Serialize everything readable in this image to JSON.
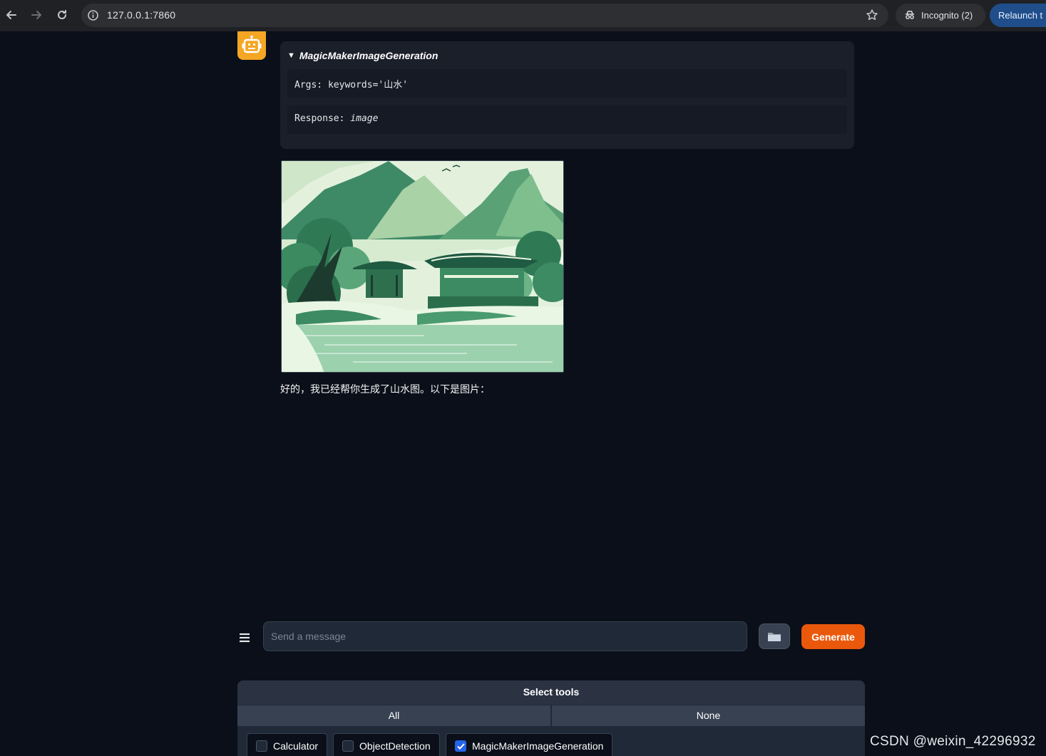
{
  "browser": {
    "url": "127.0.0.1:7860",
    "incognito_label": "Incognito (2)",
    "relaunch_label": "Relaunch t"
  },
  "chat": {
    "tool_call": {
      "name": "MagicMakerImageGeneration",
      "args_label": "Args: ",
      "args_value": "keywords='山水'",
      "response_label": "Response: ",
      "response_value": "image"
    },
    "reply_text": "好的，我已经帮你生成了山水图。以下是图片："
  },
  "input": {
    "placeholder": "Send a message",
    "generate_label": "Generate"
  },
  "tools": {
    "header": "Select tools",
    "all_label": "All",
    "none_label": "None",
    "items": [
      {
        "label": "Calculator",
        "checked": false
      },
      {
        "label": "ObjectDetection",
        "checked": false
      },
      {
        "label": "MagicMakerImageGeneration",
        "checked": true
      }
    ]
  },
  "watermark": "CSDN @weixin_42296932",
  "colors": {
    "background": "#0b0f19",
    "accent": "#ea580c",
    "avatar": "#f5a623",
    "checkbox": "#2563eb"
  }
}
